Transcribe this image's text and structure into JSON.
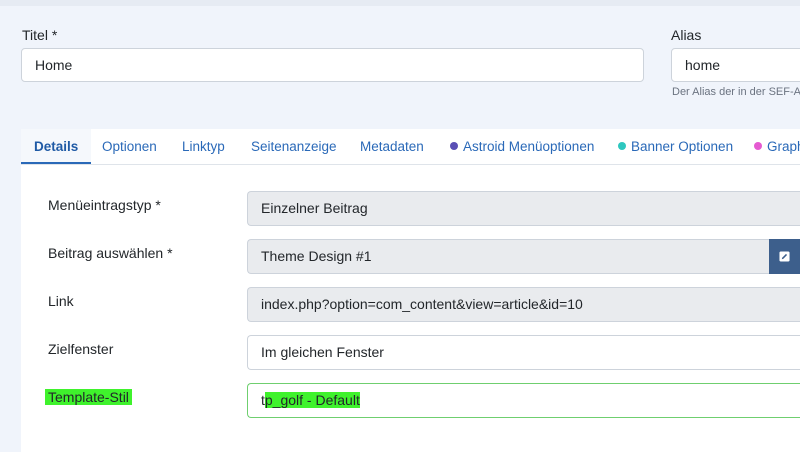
{
  "title_field": {
    "label": "Titel *",
    "value": "Home"
  },
  "alias_field": {
    "label": "Alias",
    "value": "home",
    "hint": "Der Alias der in der SEF-A"
  },
  "tabs": [
    {
      "label": "Details",
      "active": true
    },
    {
      "label": "Optionen"
    },
    {
      "label": "Linktyp"
    },
    {
      "label": "Seitenanzeige"
    },
    {
      "label": "Metadaten"
    },
    {
      "label": "Astroid Menüoptionen",
      "dot_color": "#5a4fb5"
    },
    {
      "label": "Banner Optionen",
      "dot_color": "#2ec7bf"
    },
    {
      "label": "Graph",
      "dot_color": "#e55ad1"
    }
  ],
  "details": {
    "menu_item_type": {
      "label": "Menüeintragstyp *",
      "value": "Einzelner Beitrag"
    },
    "select_article": {
      "label": "Beitrag auswählen *",
      "value": "Theme Design #1"
    },
    "link": {
      "label": "Link",
      "value": "index.php?option=com_content&view=article&id=10"
    },
    "target_window": {
      "label": "Zielfenster",
      "value": "Im gleichen Fenster"
    },
    "template_style": {
      "label": "Template-Stil",
      "value_prefix": "t",
      "value_rest": "p_golf - Default"
    }
  },
  "colors": {
    "accent": "#2a69b8",
    "edit_button": "#3d5f8c",
    "highlight": "#3ff22c"
  }
}
